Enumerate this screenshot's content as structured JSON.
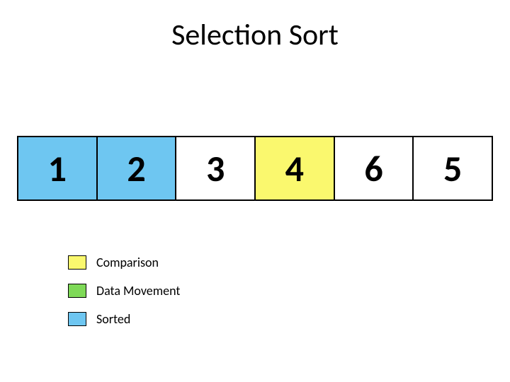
{
  "title": "Selection Sort",
  "array": {
    "cells": [
      {
        "value": "1",
        "state": "sorted"
      },
      {
        "value": "2",
        "state": "sorted"
      },
      {
        "value": "3",
        "state": "plain"
      },
      {
        "value": "4",
        "state": "comparison"
      },
      {
        "value": "6",
        "state": "plain"
      },
      {
        "value": "5",
        "state": "plain"
      }
    ]
  },
  "legend": {
    "items": [
      {
        "label": "Comparison",
        "swatch": "comparison"
      },
      {
        "label": "Data Movement",
        "swatch": "datamove"
      },
      {
        "label": "Sorted",
        "swatch": "sorted"
      }
    ]
  },
  "colors": {
    "comparison": "#faf86e",
    "datamove": "#7ed957",
    "sorted": "#6ec6f1",
    "plain": "#ffffff",
    "border": "#000000"
  }
}
